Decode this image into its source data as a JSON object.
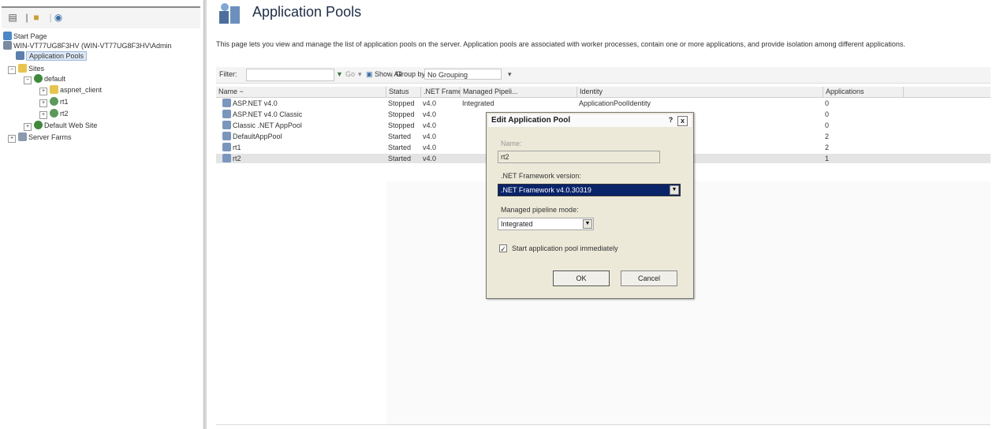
{
  "tree": {
    "nodes": [
      {
        "label": "Start Page"
      },
      {
        "label": "WIN-VT77UG8F3HV (WIN-VT77UG8F3HV\\Admin"
      },
      {
        "label": "Application Pools"
      },
      {
        "label": "Sites"
      },
      {
        "label": "default"
      },
      {
        "label": "aspnet_client"
      },
      {
        "label": "rt1"
      },
      {
        "label": "rt2"
      },
      {
        "label": "Default Web Site"
      },
      {
        "label": "Server Farms"
      }
    ]
  },
  "page": {
    "title": "Application Pools",
    "description": "This page lets you view and manage the list of application pools on the server. Application pools are associated with worker processes, contain one or more applications, and provide isolation among different applications."
  },
  "filterbar": {
    "filter_label": "Filter:",
    "go_label": "Go",
    "show_all_label": "Show All",
    "group_by_label": "Group by:",
    "group_by_value": "No Grouping"
  },
  "table": {
    "columns": [
      "Name",
      "Status",
      ".NET Frame...",
      "Managed Pipeli...",
      "Identity",
      "Applications"
    ],
    "rows": [
      {
        "name": "ASP.NET v4.0",
        "status": "Stopped",
        "net": "v4.0",
        "pipeline": "Integrated",
        "identity": "ApplicationPoolIdentity",
        "apps": "0"
      },
      {
        "name": "ASP.NET v4.0 Classic",
        "status": "Stopped",
        "net": "v4.0",
        "pipeline": "",
        "identity": "",
        "apps": "0"
      },
      {
        "name": "Classic .NET AppPool",
        "status": "Stopped",
        "net": "v4.0",
        "pipeline": "",
        "identity": "",
        "apps": "0"
      },
      {
        "name": "DefaultAppPool",
        "status": "Started",
        "net": "v4.0",
        "pipeline": "",
        "identity": "",
        "apps": "2"
      },
      {
        "name": "rt1",
        "status": "Started",
        "net": "v4.0",
        "pipeline": "",
        "identity": "",
        "apps": "2"
      },
      {
        "name": "rt2",
        "status": "Started",
        "net": "v4.0",
        "pipeline": "",
        "identity": "",
        "apps": "1"
      }
    ],
    "selected_index": 5
  },
  "dialog": {
    "title": "Edit Application Pool",
    "help_glyph": "?",
    "close_glyph": "x",
    "name_label": "Name:",
    "name_value": "rt2",
    "framework_label": ".NET Framework version:",
    "framework_value": ".NET Framework v4.0.30319",
    "pipeline_label": "Managed pipeline mode:",
    "pipeline_value": "Integrated",
    "start_checkbox_label": "Start application pool immediately",
    "start_checked": true,
    "ok_label": "OK",
    "cancel_label": "Cancel"
  },
  "colors": {
    "selection_blue": "#0a246a",
    "dialog_bg": "#ece9d8",
    "folder_yellow": "#e8c44a",
    "globe_green": "#3f8a3a"
  }
}
